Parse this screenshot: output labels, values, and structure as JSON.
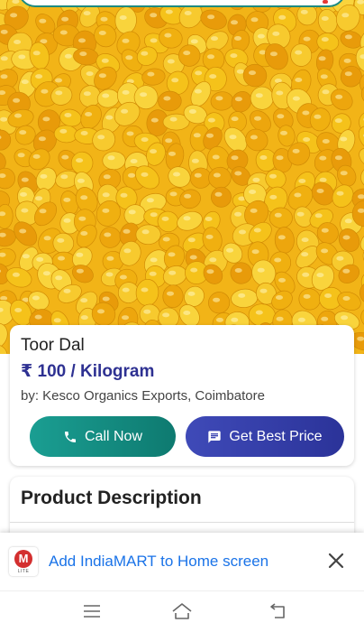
{
  "product": {
    "name": "Toor Dal",
    "price": "₹ 100 / Kilogram",
    "seller": "by: Kesco Organics Exports, Coimbatore"
  },
  "actions": {
    "call_label": "Call Now",
    "price_label": "Get Best Price"
  },
  "description": {
    "title": "Product Description"
  },
  "install_banner": {
    "logo_letter": "M",
    "logo_sub": "LITE",
    "text": "Add IndiaMART to Home screen"
  },
  "colors": {
    "brand_blue": "#2e3192",
    "call_green": "#0e7a70",
    "link_blue": "#1a73e8",
    "lentil_yellow": "#f2b417"
  },
  "icons": [
    "phone-icon",
    "message-icon",
    "close-icon",
    "menu-icon",
    "home-icon",
    "back-icon"
  ]
}
